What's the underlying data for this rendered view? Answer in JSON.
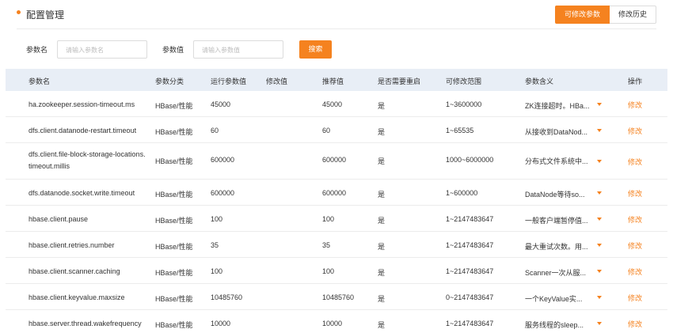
{
  "header": {
    "title": "配置管理",
    "tab_modifiable": "可修改参数",
    "tab_history": "修改历史"
  },
  "search": {
    "name_label": "参数名",
    "name_placeholder": "请输入参数名",
    "value_label": "参数值",
    "value_placeholder": "请输入参数值",
    "button": "搜索"
  },
  "table": {
    "columns": [
      "参数名",
      "参数分类",
      "运行参数值",
      "修改值",
      "推荐值",
      "是否需要重启",
      "可修改范围",
      "参数含义",
      "操作"
    ],
    "rows": [
      {
        "name": "ha.zookeeper.session-timeout.ms",
        "category": "HBase/性能",
        "running": "45000",
        "modified": "",
        "recommended": "45000",
        "restart": "是",
        "range": "1~3600000",
        "meaning": "ZK连接超时。HBa...",
        "action": "修改"
      },
      {
        "name": "dfs.client.datanode-restart.timeout",
        "category": "HBase/性能",
        "running": "60",
        "modified": "",
        "recommended": "60",
        "restart": "是",
        "range": "1~65535",
        "meaning": "从接收到DataNod...",
        "action": "修改"
      },
      {
        "name": "dfs.client.file-block-storage-locations.timeout.millis",
        "category": "HBase/性能",
        "running": "600000",
        "modified": "",
        "recommended": "600000",
        "restart": "是",
        "range": "1000~6000000",
        "meaning": "分布式文件系统中...",
        "action": "修改"
      },
      {
        "name": "dfs.datanode.socket.write.timeout",
        "category": "HBase/性能",
        "running": "600000",
        "modified": "",
        "recommended": "600000",
        "restart": "是",
        "range": "1~600000",
        "meaning": "DataNode等待so...",
        "action": "修改"
      },
      {
        "name": "hbase.client.pause",
        "category": "HBase/性能",
        "running": "100",
        "modified": "",
        "recommended": "100",
        "restart": "是",
        "range": "1~2147483647",
        "meaning": "一般客户端暂停值...",
        "action": "修改"
      },
      {
        "name": "hbase.client.retries.number",
        "category": "HBase/性能",
        "running": "35",
        "modified": "",
        "recommended": "35",
        "restart": "是",
        "range": "1~2147483647",
        "meaning": "最大重试次数。用...",
        "action": "修改"
      },
      {
        "name": "hbase.client.scanner.caching",
        "category": "HBase/性能",
        "running": "100",
        "modified": "",
        "recommended": "100",
        "restart": "是",
        "range": "1~2147483647",
        "meaning": "Scanner一次从服...",
        "action": "修改"
      },
      {
        "name": "hbase.client.keyvalue.maxsize",
        "category": "HBase/性能",
        "running": "10485760",
        "modified": "",
        "recommended": "10485760",
        "restart": "是",
        "range": "0~2147483647",
        "meaning": "一个KeyValue实...",
        "action": "修改"
      },
      {
        "name": "hbase.server.thread.wakefrequency",
        "category": "HBase/性能",
        "running": "10000",
        "modified": "",
        "recommended": "10000",
        "restart": "是",
        "range": "1~2147483647",
        "meaning": "服务线程的sleep...",
        "action": "修改"
      }
    ]
  },
  "colors": {
    "accent": "#f5821f",
    "header_bg": "#e8eef6",
    "border": "#ececec"
  }
}
